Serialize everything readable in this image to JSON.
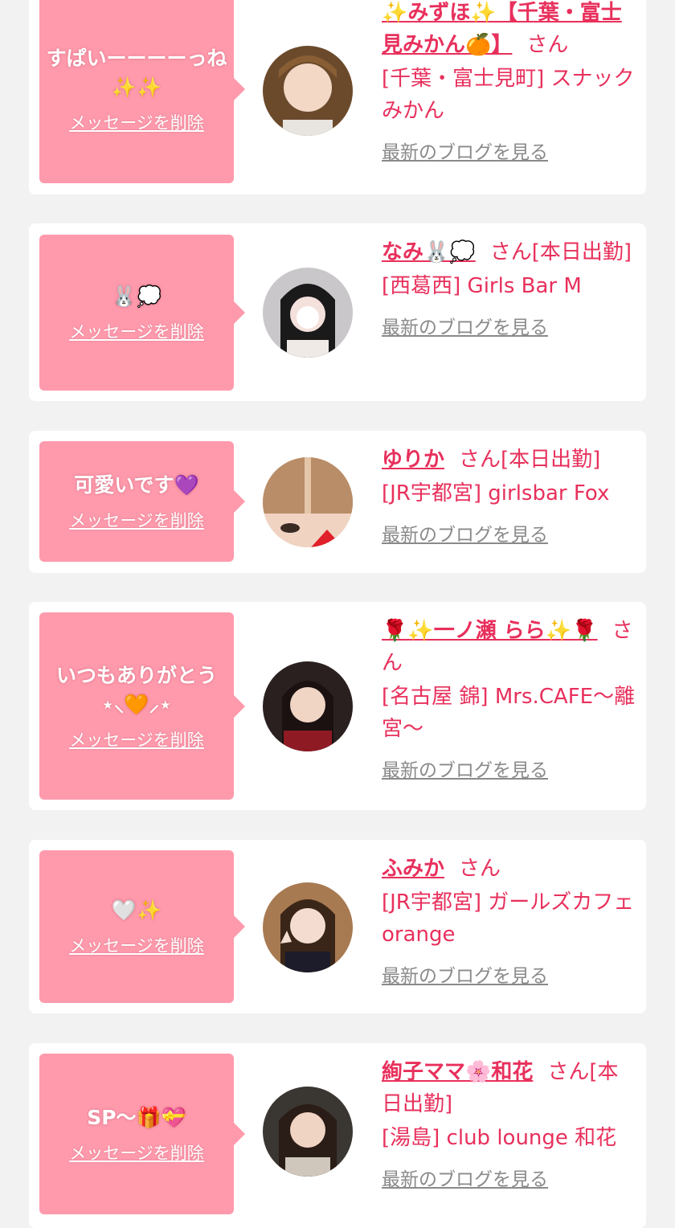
{
  "colors": {
    "page_bg": "#f2f2f2",
    "card_bg": "#ffffff",
    "bubble": "#ff9aac",
    "accent": "#e8305c",
    "link_gray": "#8a8a8a"
  },
  "delete_label": "メッセージを削除",
  "blog_label": "最新のブログを見る",
  "san_label": "さん",
  "messages": [
    {
      "message": "すぱいーーーーっね✨✨",
      "name": "✨みずほ✨【千葉・富士見みかん🍊】",
      "status": "",
      "store": "[千葉・富士見町] スナックみかん"
    },
    {
      "message": "🐰💭",
      "name": "なみ🐰💭",
      "status": "[本日出勤]",
      "store": "[西葛西] Girls Bar M"
    },
    {
      "message": "可愛いです💜",
      "name": "ゆりか",
      "status": "[本日出勤]",
      "store": "[JR宇都宮] girlsbar Fox"
    },
    {
      "message": "いつもありがとう⋆⸜🧡⸝⋆",
      "name": "🌹✨一ノ瀬 らら✨🌹",
      "status": "",
      "store": "[名古屋 錦] Mrs.CAFE〜離宮〜"
    },
    {
      "message": "🤍✨",
      "name": "ふみか",
      "status": "",
      "store": "[JR宇都宮] ガールズカフェ orange"
    },
    {
      "message": "SP〜🎁💝",
      "name": "絢子ママ🌸和花",
      "status": "[本日出勤]",
      "store": "[湯島] club lounge 和花"
    }
  ]
}
